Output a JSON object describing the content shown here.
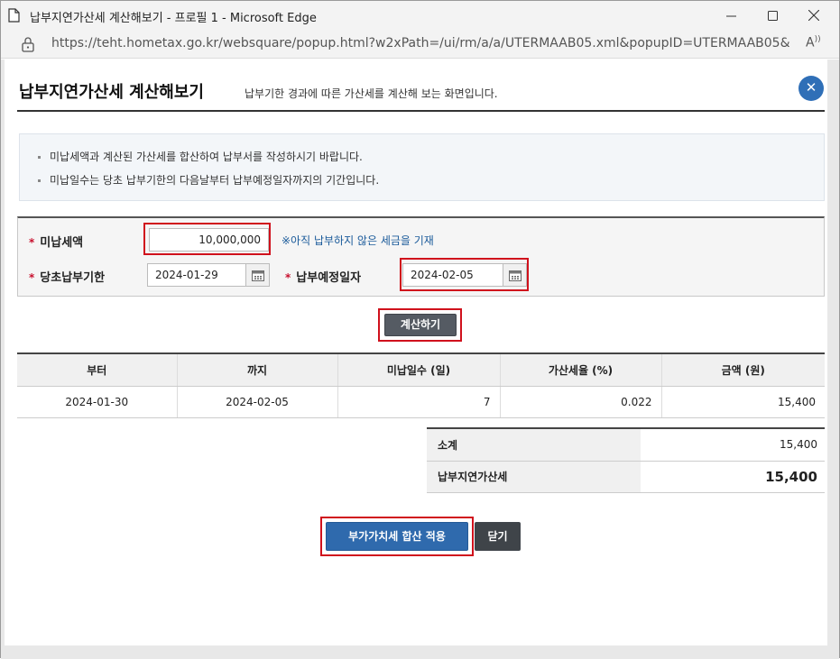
{
  "window": {
    "title": "납부지연가산세 계산해보기 - 프로필 1 - Microsoft Edge",
    "url": "https://teht.hometax.go.kr/websquare/popup.html?w2xPath=/ui/rm/a/a/UTERMAAB05.xml&popupID=UTERMAAB05&..."
  },
  "header": {
    "title": "납부지연가산세 계산해보기",
    "subtitle": "납부기한 경과에 따른 가산세를 계산해 보는 화면입니다."
  },
  "notice": {
    "lines": [
      "미납세액과 계산된 가산세를 합산하여 납부서를 작성하시기 바랍니다.",
      "미납일수는 당초 납부기한의 다음날부터 납부예정일자까지의 기간입니다."
    ]
  },
  "form": {
    "required_mark": "*",
    "unpaid_tax_label": "미납세액",
    "unpaid_tax_value": "10,000,000",
    "unpaid_tax_hint": "※아직 납부하지 않은 세금을 기재",
    "original_due_label": "당초납부기한",
    "original_due_value": "2024-01-29",
    "planned_date_label": "납부예정일자",
    "planned_date_value": "2024-02-05",
    "calculate_label": "계산하기"
  },
  "result_table": {
    "headers": [
      "부터",
      "까지",
      "미납일수 (일)",
      "가산세율 (%)",
      "금액 (원)"
    ],
    "rows": [
      [
        "2024-01-30",
        "2024-02-05",
        "7",
        "0.022",
        "15,400"
      ]
    ]
  },
  "summary": {
    "subtotal_label": "소계",
    "subtotal_value": "15,400",
    "total_label": "납부지연가산세",
    "total_value": "15,400"
  },
  "buttons": {
    "apply_label": "부가가치세 합산 적용",
    "close_label": "닫기"
  },
  "colors": {
    "accent_blue": "#2f6aad",
    "highlight_red": "#d0111c",
    "required_red": "#c8102e",
    "dark_button": "#555b63"
  }
}
